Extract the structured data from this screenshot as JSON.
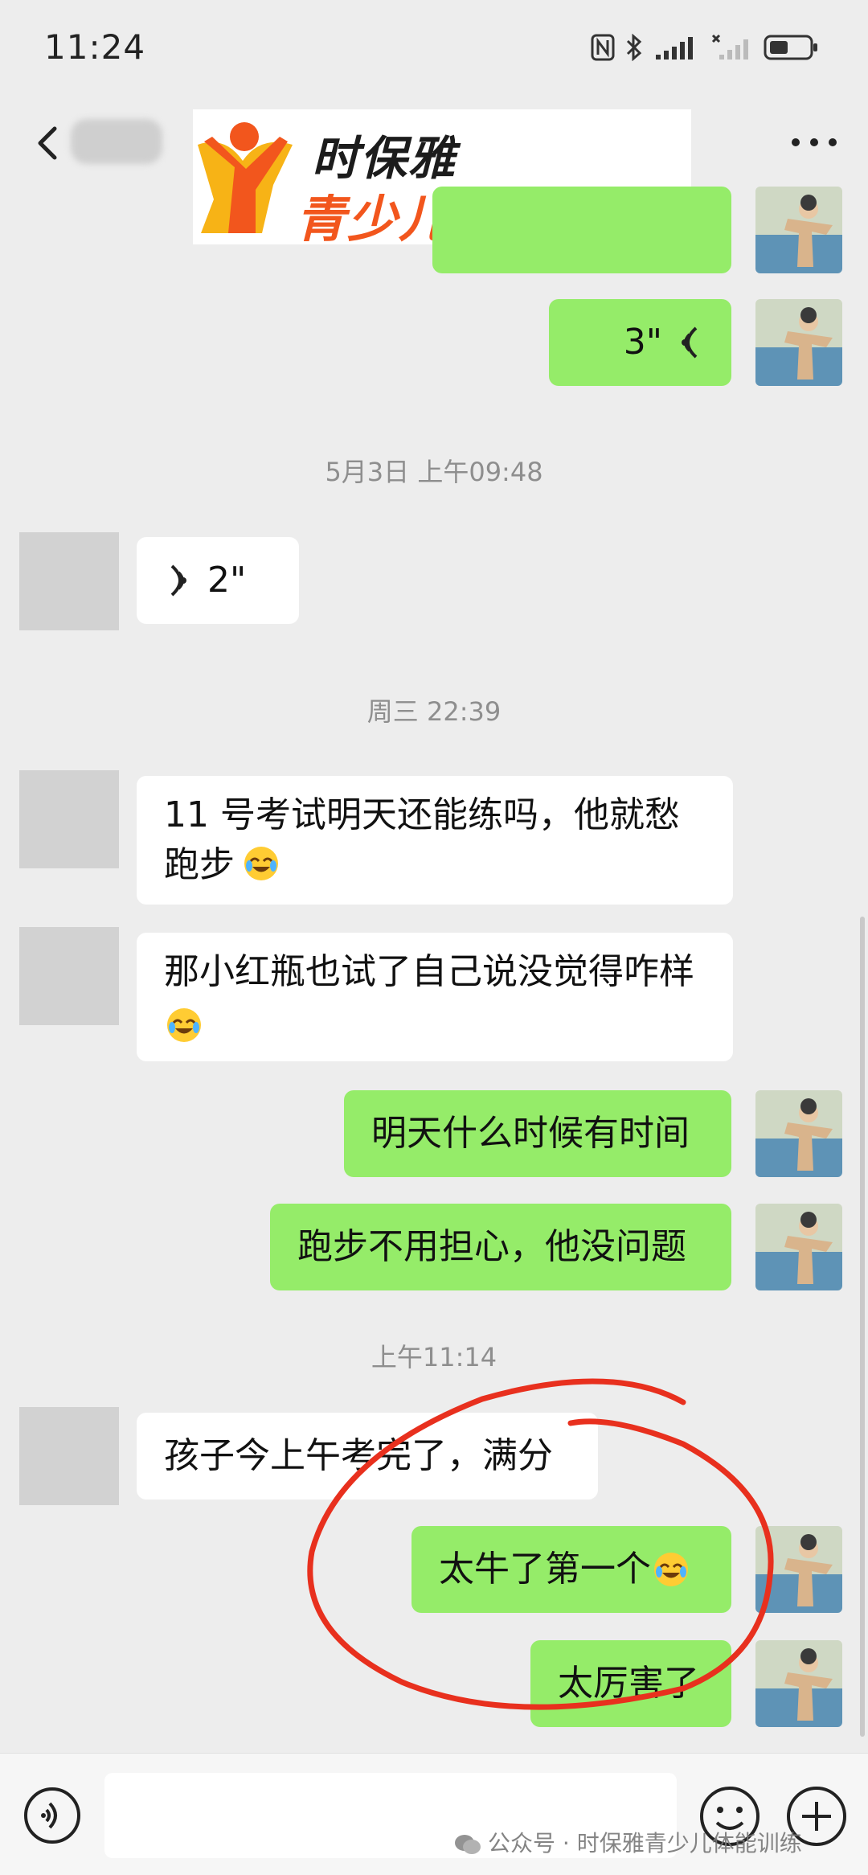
{
  "status_bar": {
    "time": "11:24",
    "icons": [
      "nfc-icon",
      "bluetooth-icon",
      "signal-icon",
      "signal-x-icon",
      "battery-icon"
    ]
  },
  "nav": {
    "back_icon": "chevron-left-icon",
    "more_icon": "more-dots-icon"
  },
  "banner": {
    "brand_name": "时保雅",
    "tagline": "青少儿体能训练",
    "colors": {
      "orange": "#f2561d",
      "yellow": "#f7b316"
    }
  },
  "messages": [
    {
      "side": "right",
      "type": "voice",
      "text": "3\""
    },
    {
      "type": "timestamp",
      "text": "5月3日 上午09:48"
    },
    {
      "side": "left",
      "type": "voice",
      "text": "2\""
    },
    {
      "type": "timestamp",
      "text": "周三 22:39"
    },
    {
      "side": "left",
      "type": "text",
      "text": "11 号考试明天还能练吗，他就愁\n跑步",
      "emoji": "laugh-cry-emoji"
    },
    {
      "side": "left",
      "type": "text",
      "text": "那小红瓶也试了自己说没觉得咋样",
      "emoji": "laugh-cry-emoji"
    },
    {
      "side": "right",
      "type": "text",
      "text": "明天什么时候有时间"
    },
    {
      "side": "right",
      "type": "text",
      "text": "跑步不用担心，他没问题"
    },
    {
      "type": "timestamp",
      "text": "上午11:14"
    },
    {
      "side": "left",
      "type": "text",
      "text": "孩子今上午考完了，满分"
    },
    {
      "side": "right",
      "type": "text",
      "text": "太牛了第一个",
      "emoji": "laugh-cry-emoji"
    },
    {
      "side": "right",
      "type": "text",
      "text": "太厉害了"
    }
  ],
  "input_bar": {
    "voice_icon": "voice-input-icon",
    "emoji_icon": "smiley-icon",
    "plus_icon": "plus-icon",
    "watermark": "公众号 · 时保雅青少儿体能训练"
  },
  "colors": {
    "green_bubble": "#95ec69",
    "white_bubble": "#ffffff",
    "background": "#ededed",
    "annotation_red": "#e8301e"
  }
}
